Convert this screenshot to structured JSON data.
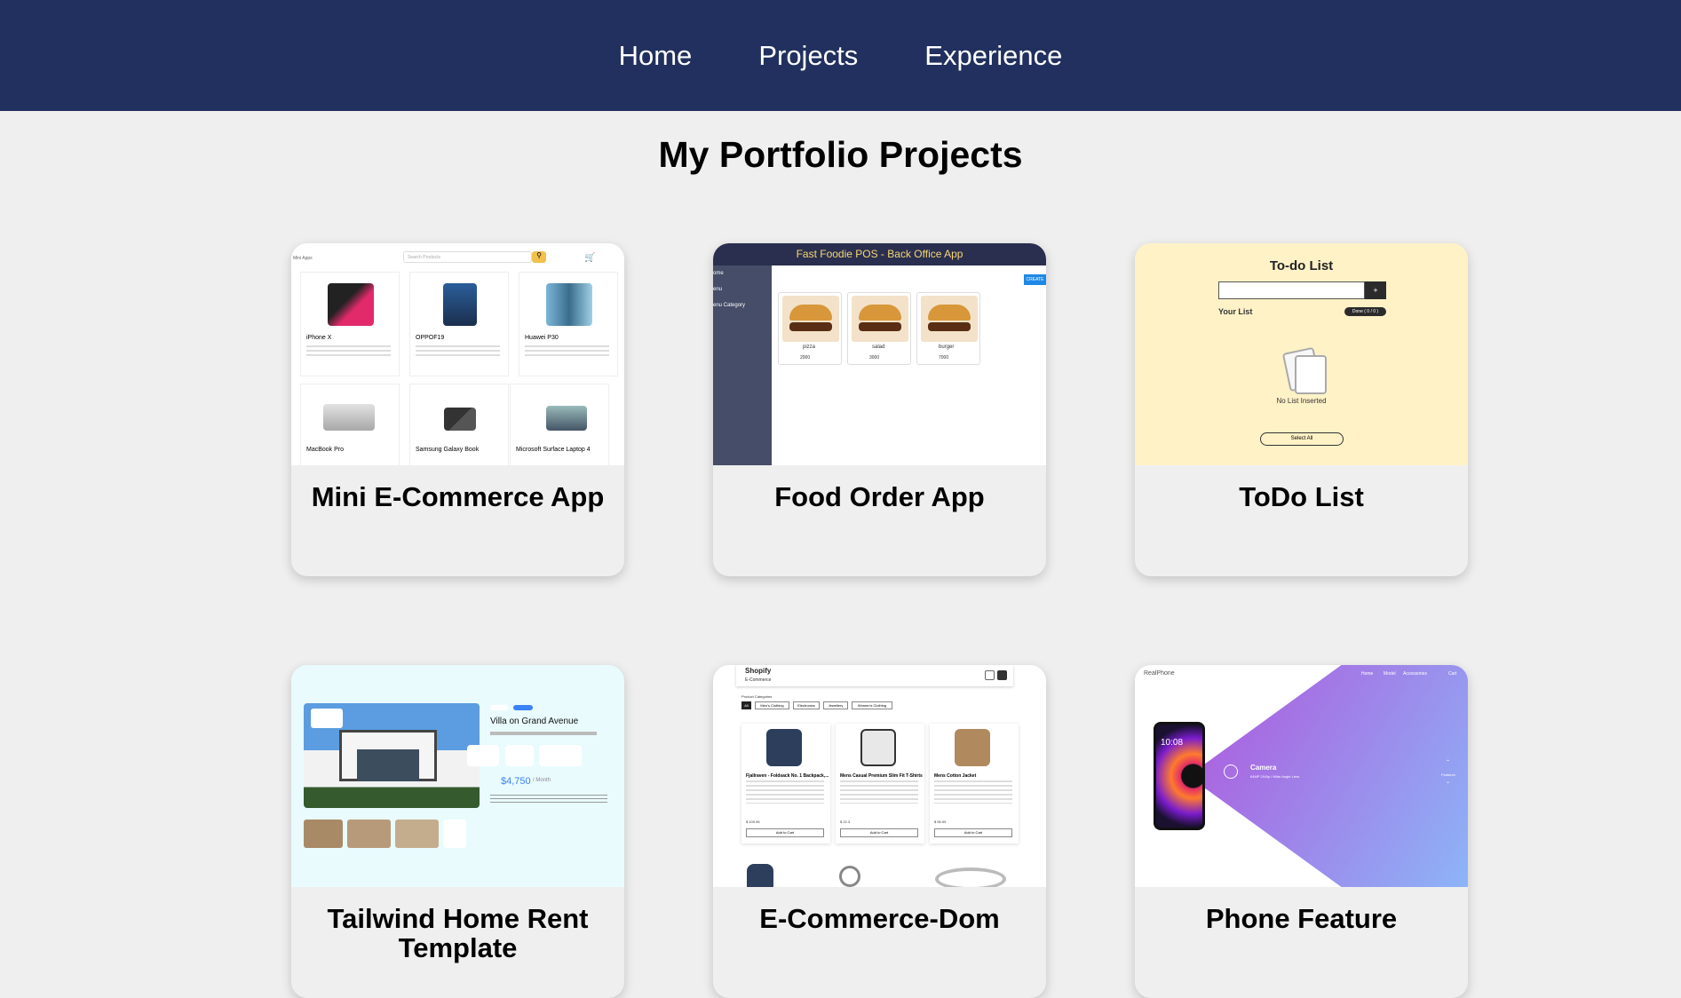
{
  "nav": {
    "items": [
      "Home",
      "Projects",
      "Experience"
    ]
  },
  "page_title": "My Portfolio Projects",
  "projects": [
    {
      "title": "Mini E-Commerce App"
    },
    {
      "title": "Food Order App"
    },
    {
      "title": "ToDo List"
    },
    {
      "title": "Tailwind Home Rent Template"
    },
    {
      "title": "E-Commerce-Dom"
    },
    {
      "title": "Phone Feature"
    }
  ],
  "thumbs": {
    "ecommerce": {
      "brand": "Mini Apps",
      "search_placeholder": "Search Products",
      "products": [
        "iPhone X",
        "OPPOF19",
        "Huawei P30",
        "MacBook Pro",
        "Samsung Galaxy Book",
        "Microsoft Surface Laptop 4"
      ]
    },
    "food": {
      "header": "Fast Foodie POS - Back Office App",
      "menu": [
        "ome",
        "enu",
        "enu Category"
      ],
      "create": "CREATE",
      "items": [
        {
          "name": "pizza",
          "price": "2000"
        },
        {
          "name": "salad",
          "price": "3000"
        },
        {
          "name": "burger",
          "price": "7000"
        }
      ]
    },
    "todo": {
      "title": "To-do List",
      "add": "+",
      "your_list": "Your List",
      "badge": "Done ( 0 / 0 )",
      "empty": "No List Inserted",
      "select_all": "Select All"
    },
    "rent": {
      "name": "Villa on Grand Avenue",
      "price": "$4,750",
      "per": "/ Month"
    },
    "shopify": {
      "brand": "Shopify",
      "sub": "E-Commerce",
      "categories_label": "Product Categories",
      "categories": [
        "All",
        "Men's Clothing",
        "Electronics",
        "Jewellery",
        "Women's Clothing"
      ],
      "products": [
        {
          "name": "Fjallraven - Foldsack No. 1 Backpack,...",
          "price": "$ 109.95",
          "rating": "( 3.9 / 5 )",
          "btn": "Add to Cart"
        },
        {
          "name": "Mens Casual Premium Slim Fit T-Shirts",
          "price": "$ 22.3",
          "rating": "( 4.1 / 5 )",
          "btn": "Add to Cart"
        },
        {
          "name": "Mens Cotton Jacket",
          "price": "$ 55.99",
          "rating": "( 4.7 / 5 )",
          "btn": "Add to Cart"
        }
      ]
    },
    "phone": {
      "brand": "RealPhone",
      "links": [
        "Home",
        "Model",
        "Accessories",
        "Cart"
      ],
      "feature": "Camera",
      "feature_sub": "64MP 2X/8p / Wide Angle Lens",
      "time": "10:08",
      "side": "Features"
    }
  },
  "colors": {
    "nav_bg": "#21305e",
    "page_bg": "#efefef",
    "todo_bg": "#fff2c7",
    "rent_bg": "#e9fbfd",
    "phone_grad_a": "#b449d8",
    "phone_grad_b": "#8db4f7"
  }
}
